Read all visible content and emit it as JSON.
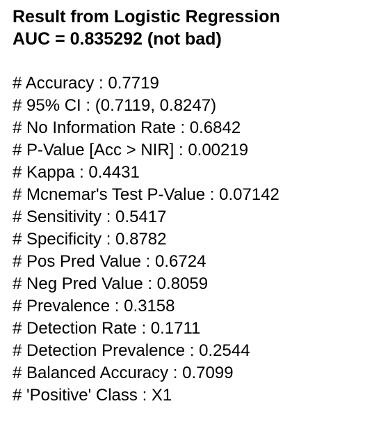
{
  "heading": {
    "title": "Result from Logistic Regression",
    "auc_line": "AUC = 0.835292 (not bad)"
  },
  "stats": [
    "# Accuracy : 0.7719",
    "# 95% CI : (0.7119, 0.8247)",
    "# No Information Rate : 0.6842",
    "# P-Value [Acc > NIR] : 0.00219",
    "# Kappa : 0.4431",
    "# Mcnemar's Test P-Value : 0.07142",
    "# Sensitivity : 0.5417",
    "# Specificity : 0.8782",
    "# Pos Pred Value : 0.6724",
    "# Neg Pred Value : 0.8059",
    "# Prevalence : 0.3158",
    "# Detection Rate : 0.1711",
    "# Detection Prevalence : 0.2544",
    "# Balanced Accuracy : 0.7099",
    "# 'Positive' Class : X1"
  ]
}
